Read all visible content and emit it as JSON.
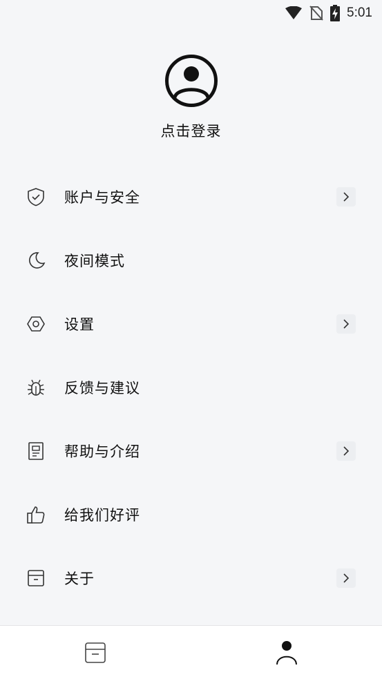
{
  "status_bar": {
    "time": "5:01",
    "icons": [
      "wifi-icon",
      "no-sim-icon",
      "battery-charging-icon"
    ]
  },
  "profile": {
    "avatar_icon": "user-circle-icon",
    "login_text": "点击登录"
  },
  "menu": {
    "items": [
      {
        "label": "账户与安全",
        "icon": "shield-check-icon",
        "has_arrow": true
      },
      {
        "label": "夜间模式",
        "icon": "moon-icon",
        "has_arrow": false
      },
      {
        "label": "设置",
        "icon": "hexagon-settings-icon",
        "has_arrow": true
      },
      {
        "label": "反馈与建议",
        "icon": "bug-icon",
        "has_arrow": false
      },
      {
        "label": "帮助与介绍",
        "icon": "document-icon",
        "has_arrow": true
      },
      {
        "label": "给我们好评",
        "icon": "thumbs-up-icon",
        "has_arrow": false
      },
      {
        "label": "关于",
        "icon": "archive-box-icon",
        "has_arrow": true
      }
    ]
  },
  "bottom_nav": {
    "tabs": [
      {
        "icon": "archive-box-icon",
        "active": false
      },
      {
        "icon": "person-icon",
        "active": true
      }
    ]
  },
  "colors": {
    "background": "#f5f6f8",
    "nav_background": "#ffffff",
    "text": "#111111",
    "icon": "#333333"
  }
}
